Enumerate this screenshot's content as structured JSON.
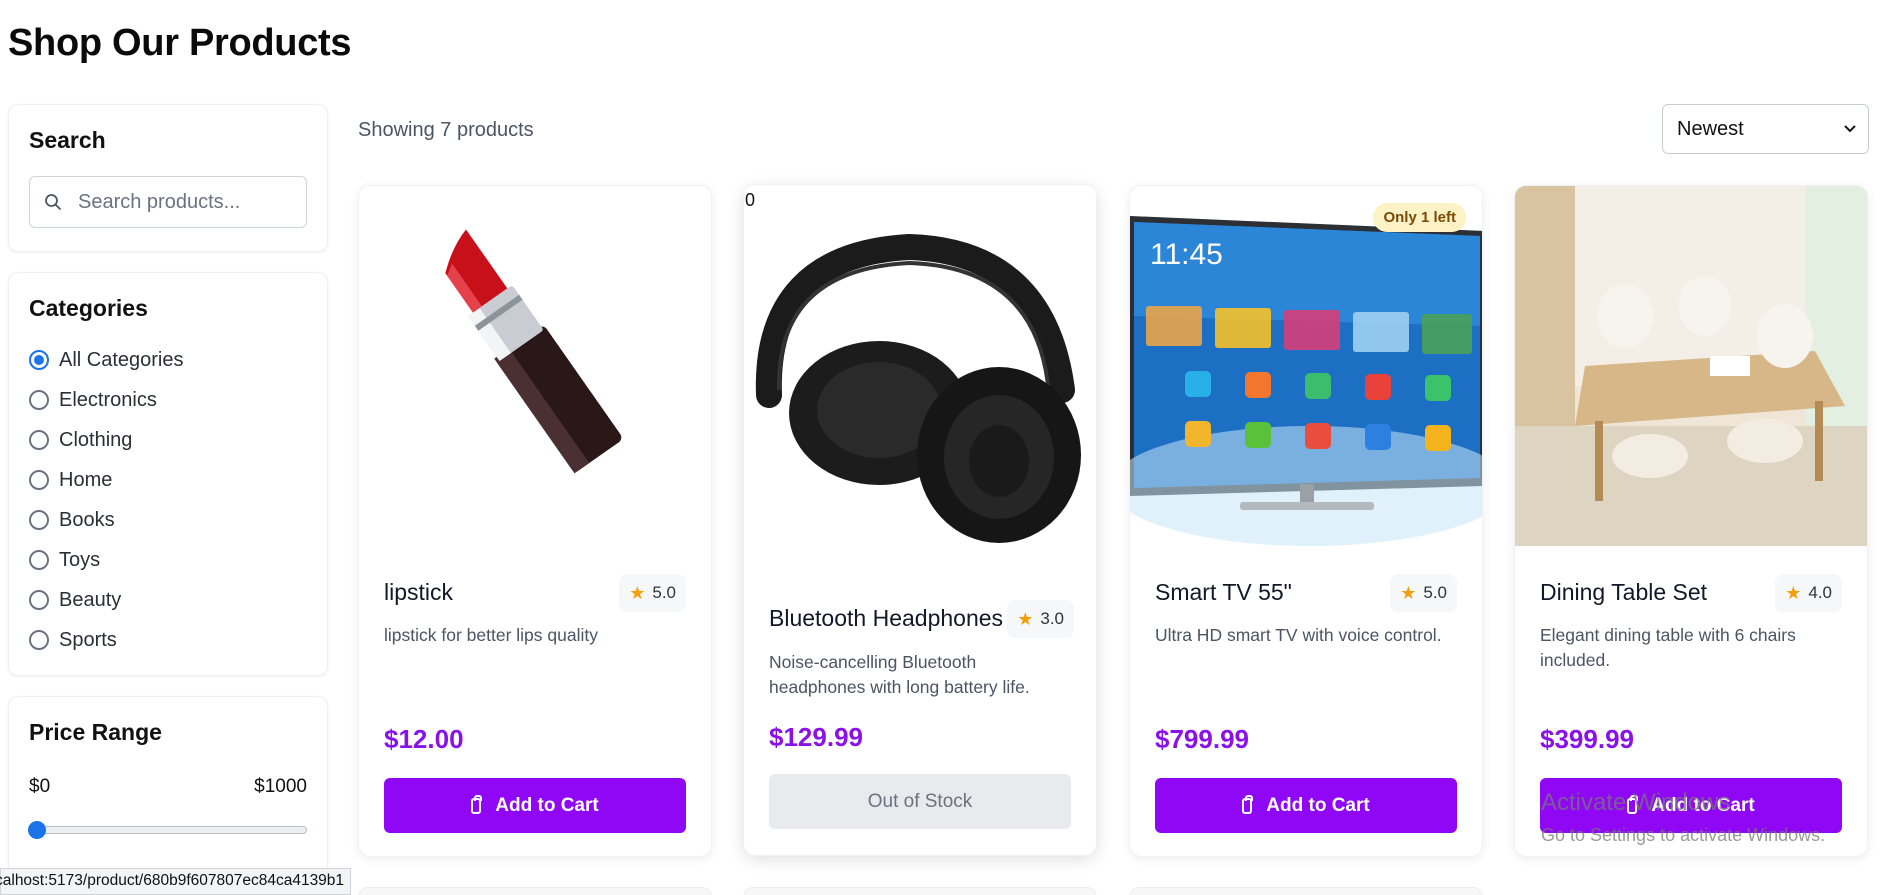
{
  "page": {
    "title": "Shop Our Products"
  },
  "search": {
    "title": "Search",
    "placeholder": "Search products..."
  },
  "categories": {
    "title": "Categories",
    "selected": "All Categories",
    "items": [
      "All Categories",
      "Electronics",
      "Clothing",
      "Home",
      "Books",
      "Toys",
      "Beauty",
      "Sports"
    ]
  },
  "price_range": {
    "title": "Price Range",
    "min_label": "$0",
    "max_label": "$1000",
    "value": 0
  },
  "results": {
    "count_text": "Showing 7 products"
  },
  "sort": {
    "selected": "Newest"
  },
  "products": [
    {
      "name": "lipstick",
      "rating": "5.0",
      "description": "lipstick for better lips quality",
      "price": "$12.00",
      "button": "Add to Cart",
      "image_icon": "lipstick-image"
    },
    {
      "name": "Bluetooth Headphones",
      "rating": "3.0",
      "description": "Noise-cancelling Bluetooth headphones with long battery life.",
      "price": "$129.99",
      "button": "Out of Stock",
      "stock_count": "0",
      "image_icon": "headphones-image"
    },
    {
      "name": "Smart TV 55\"",
      "rating": "5.0",
      "description": "Ultra HD smart TV with voice control.",
      "price": "$799.99",
      "button": "Add to Cart",
      "badge": "Only 1 left",
      "tv_time": "11:45",
      "image_icon": "smart-tv-image"
    },
    {
      "name": "Dining Table Set",
      "rating": "4.0",
      "description": "Elegant dining table with 6 chairs included.",
      "price": "$399.99",
      "button": "Add to Cart",
      "image_icon": "dining-table-image"
    }
  ],
  "status_bar": {
    "url": "calhost:5173/product/680b9f607807ec84ca4139b1"
  },
  "os_watermark": {
    "line1": "Activate Windows",
    "line2": "Go to Settings to activate Windows."
  },
  "colors": {
    "accent": "#8f07f5",
    "price": "#8a12e8",
    "radio": "#1a73e8",
    "star": "#f59e0b",
    "badge_bg": "#fdf1c6"
  }
}
